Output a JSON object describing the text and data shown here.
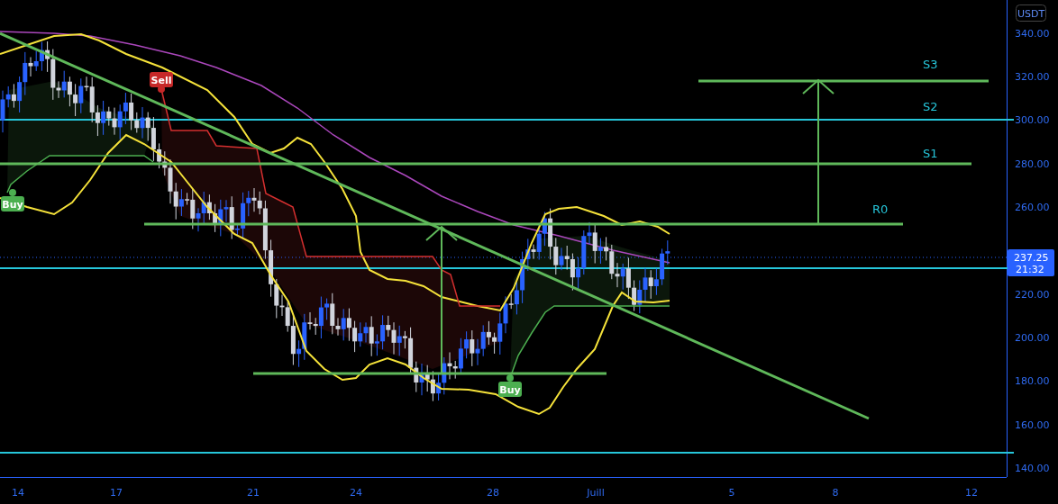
{
  "currency": "USDT",
  "price_axis": [
    "340.00",
    "320.00",
    "300.00",
    "280.00",
    "260.00",
    "220.00",
    "200.00",
    "180.00",
    "160.00",
    "140.00"
  ],
  "time_axis": [
    "14",
    "17",
    "21",
    "24",
    "28",
    "Juill",
    "5",
    "8",
    "12"
  ],
  "last_price": {
    "price": "237.25",
    "countdown": "21:32"
  },
  "levels": [
    {
      "label": "S3"
    },
    {
      "label": "S2"
    },
    {
      "label": "S1"
    },
    {
      "label": "R0"
    }
  ],
  "signals": [
    {
      "kind": "sell",
      "label": "Sell"
    },
    {
      "kind": "buy",
      "label": "Buy"
    },
    {
      "kind": "buy",
      "label": "Buy"
    }
  ]
}
